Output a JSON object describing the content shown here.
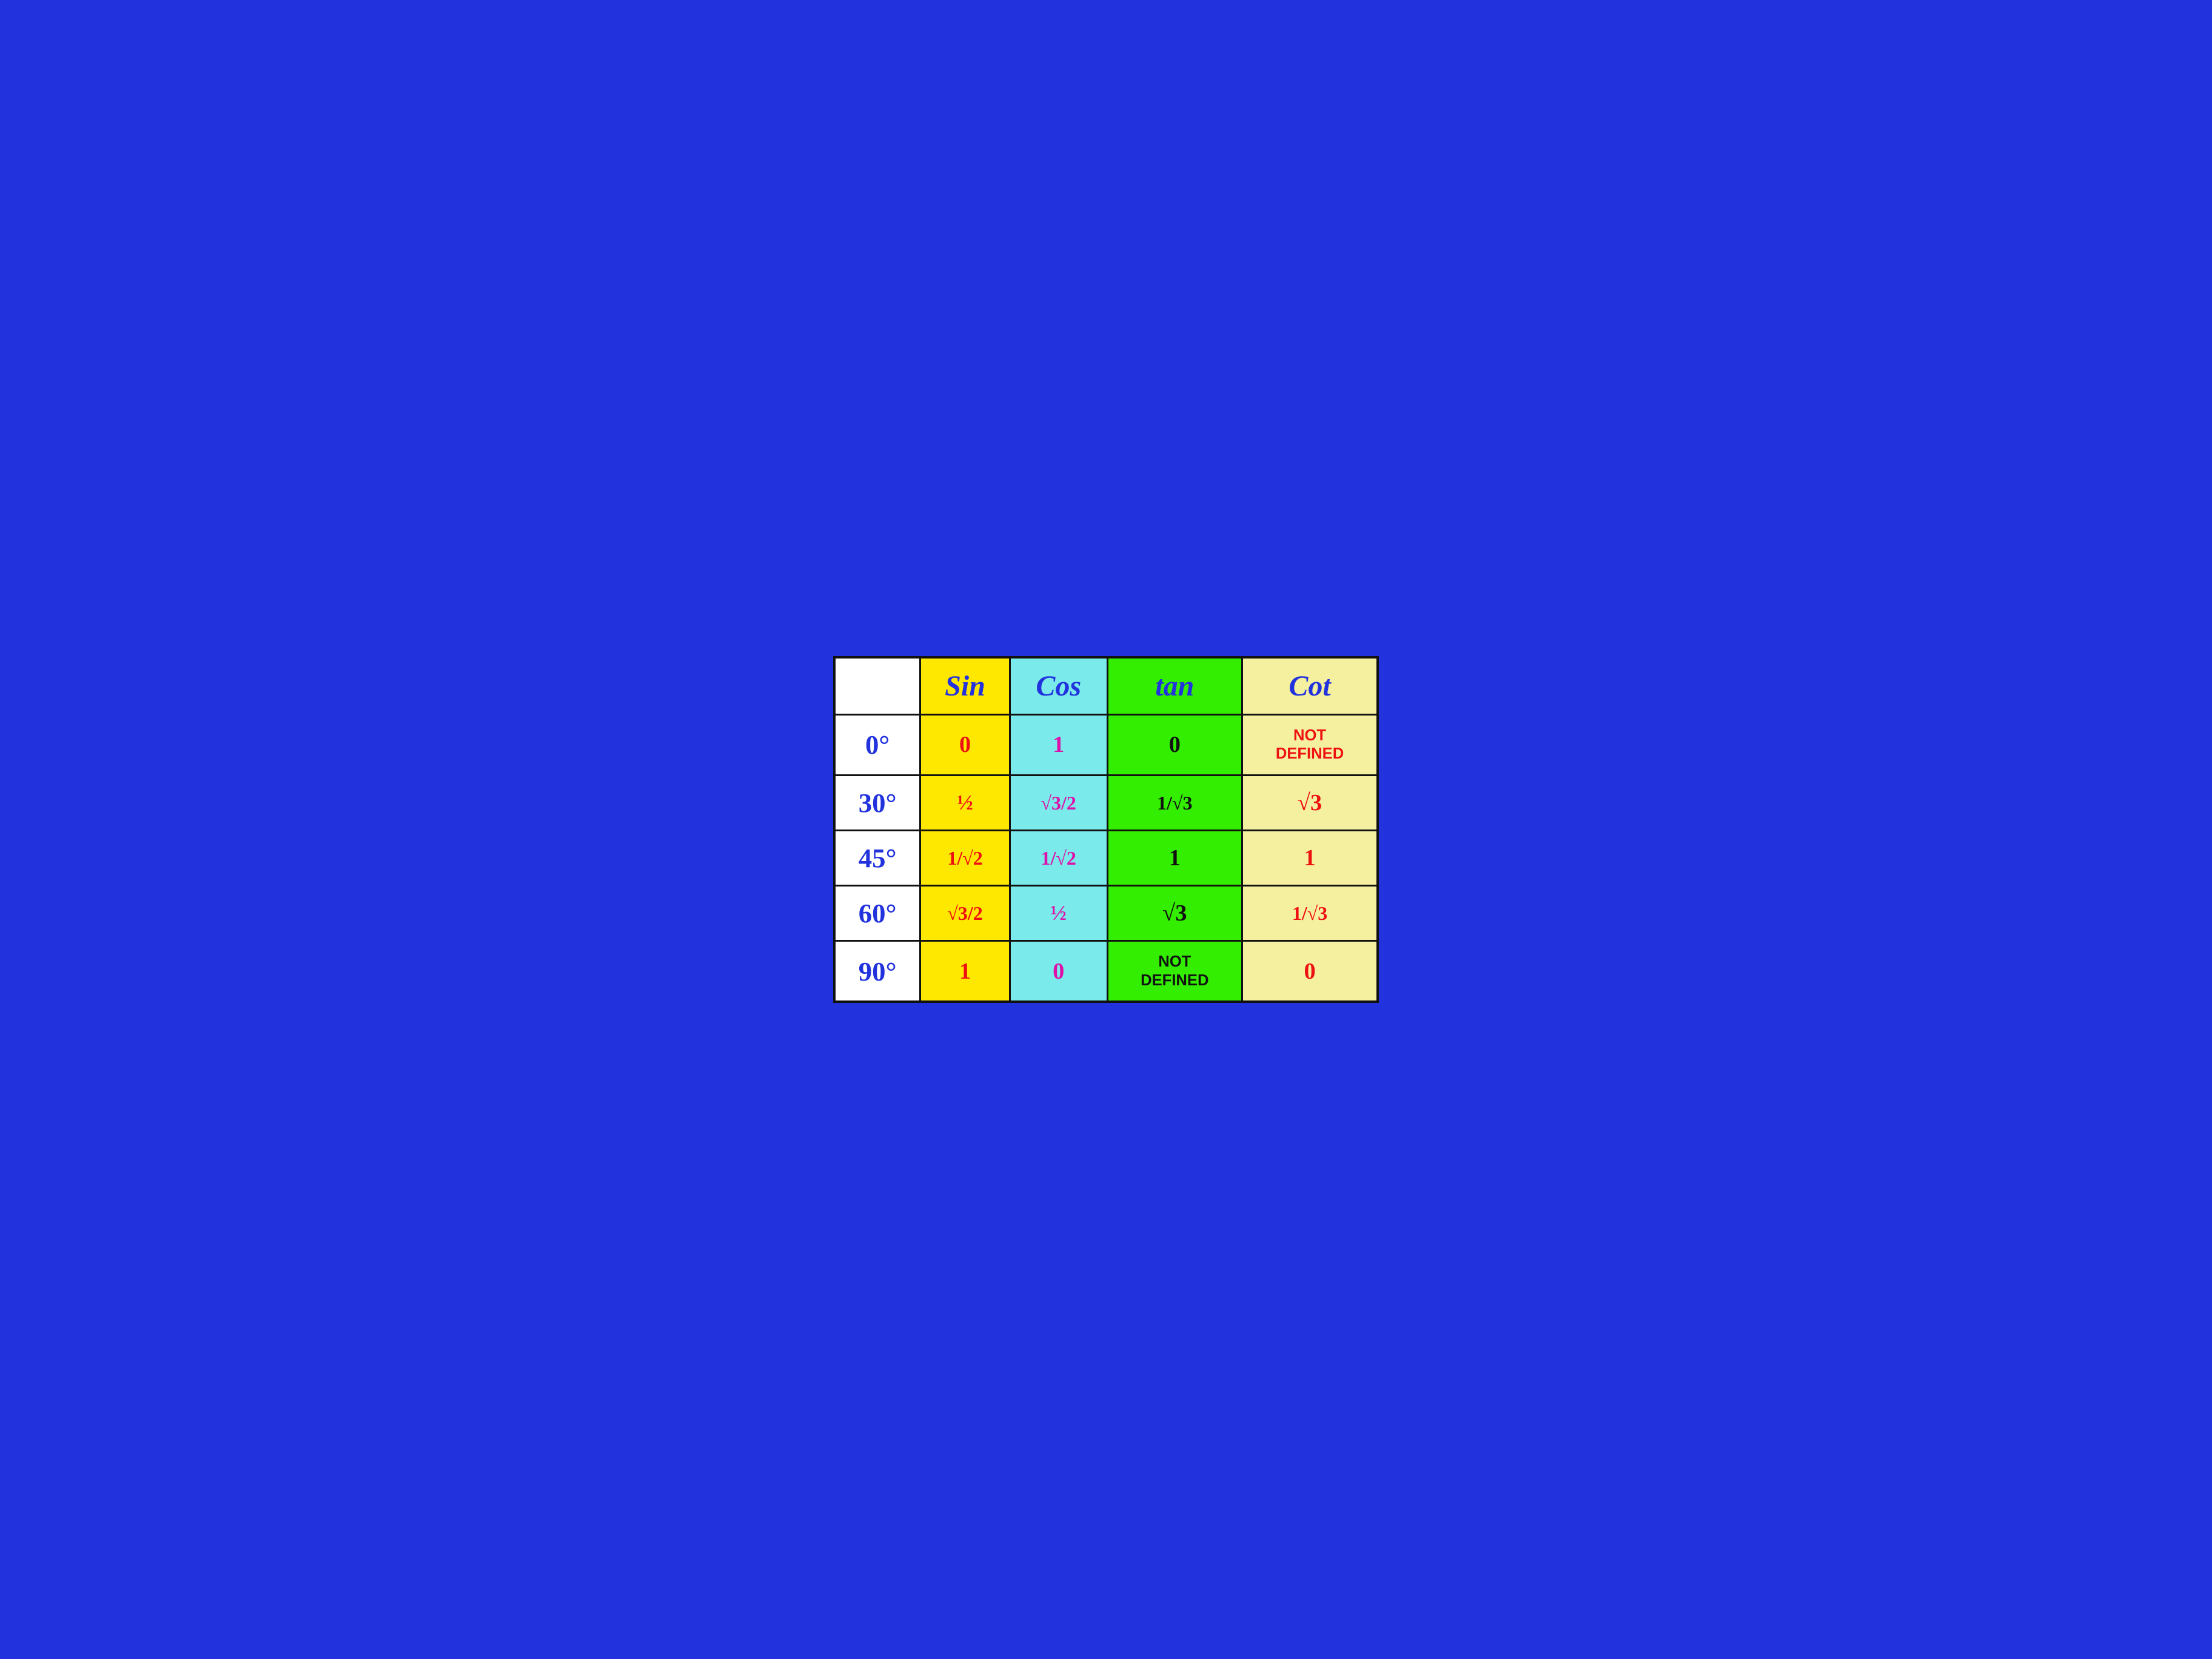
{
  "table": {
    "headers": {
      "angle": "",
      "sin": "Sin",
      "cos": "Cos",
      "tan": "tan",
      "cot": "Cot"
    },
    "rows": [
      {
        "angle": "0°",
        "sin": "0",
        "cos": "1",
        "tan": "0",
        "cot": "Not Defined",
        "cot_type": "not-defined"
      },
      {
        "angle": "30°",
        "sin": "½",
        "cos": "√3/2",
        "tan": "1/√3",
        "cot": "√3",
        "cot_type": "normal"
      },
      {
        "angle": "45°",
        "sin": "1/√2",
        "cos": "1/√2",
        "tan": "1",
        "cot": "1",
        "cot_type": "normal"
      },
      {
        "angle": "60°",
        "sin": "√3/2",
        "cos": "½",
        "tan": "√3",
        "cot": "1/√3",
        "cot_type": "normal"
      },
      {
        "angle": "90°",
        "sin": "1",
        "cos": "0",
        "tan": "Not Defined",
        "cot": "0",
        "cot_type": "normal",
        "tan_type": "not-defined"
      }
    ]
  }
}
